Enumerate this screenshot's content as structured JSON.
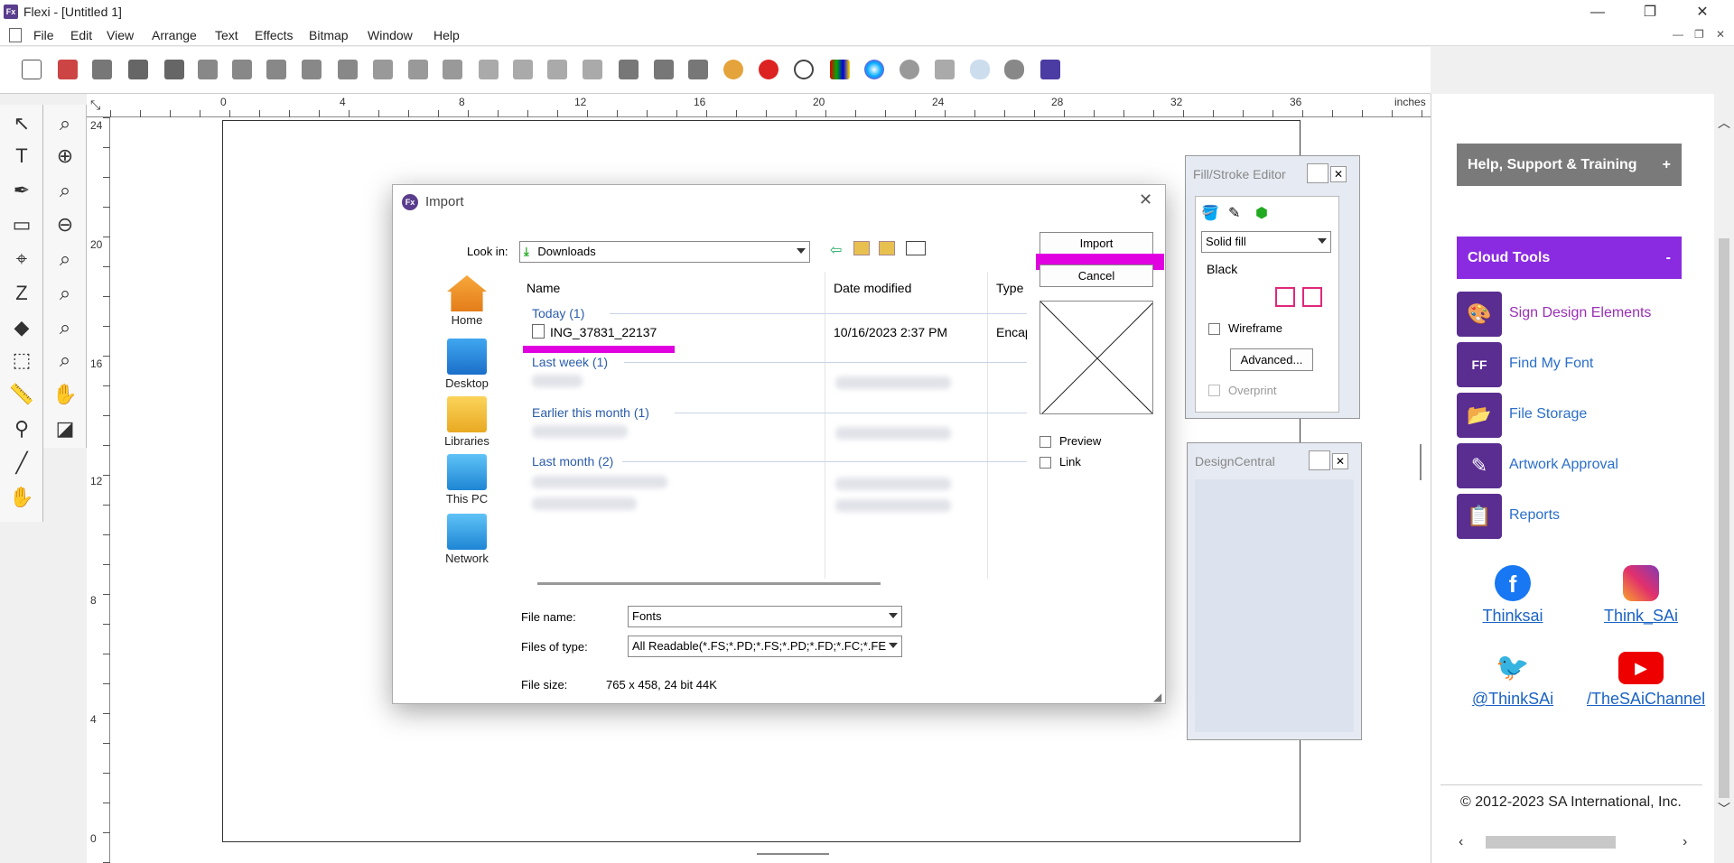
{
  "window": {
    "title": "Flexi - [Untitled 1]",
    "app_icon": "Fx"
  },
  "menu": [
    "File",
    "Edit",
    "View",
    "Arrange",
    "Text",
    "Effects",
    "Bitmap",
    "Window",
    "Help"
  ],
  "ruler": {
    "unit": "inches",
    "h_ticks": [
      "0",
      "4",
      "8",
      "12",
      "16",
      "20",
      "24",
      "28",
      "32",
      "36"
    ],
    "v_ticks": [
      "24",
      "20",
      "16",
      "12",
      "8",
      "4",
      "0"
    ]
  },
  "colors": {
    "accent_purple": "#5a2d91",
    "cloud_tools_bg": "#8a2be2",
    "help_bg": "#7a7a7a",
    "highlight_magenta": "#e000e0",
    "link_blue": "#2a6fc9"
  },
  "fill_stroke": {
    "title": "Fill/Stroke Editor",
    "fill_type": "Solid fill",
    "color_name": "Black",
    "wireframe_label": "Wireframe",
    "advanced_label": "Advanced...",
    "overprint_label": "Overprint"
  },
  "design_central": {
    "title": "DesignCentral"
  },
  "right_panel": {
    "help_header": "Help, Support & Training",
    "help_toggle": "+",
    "cloud_header": "Cloud Tools",
    "cloud_toggle": "-",
    "items": [
      {
        "label": "Sign Design Elements",
        "icon": "palette-icon"
      },
      {
        "label": "Find My Font",
        "icon": "ff-icon"
      },
      {
        "label": "File Storage",
        "icon": "folder-icon"
      },
      {
        "label": "Artwork Approval",
        "icon": "pen-icon"
      },
      {
        "label": "Reports",
        "icon": "report-icon"
      }
    ],
    "social": [
      {
        "label": "Thinksai",
        "icon": "facebook-icon"
      },
      {
        "label": "Think_SAi",
        "icon": "instagram-icon"
      },
      {
        "label": "@ThinkSAi",
        "icon": "twitter-icon"
      },
      {
        "label": "/TheSAiChannel",
        "icon": "youtube-icon"
      }
    ],
    "copyright": "© 2012-2023 SA International, Inc."
  },
  "dialog": {
    "title": "Import",
    "look_in_label": "Look in:",
    "look_in_value": "Downloads",
    "places": [
      "Home",
      "Desktop",
      "Libraries",
      "This PC",
      "Network"
    ],
    "columns": [
      "Name",
      "Date modified",
      "Type"
    ],
    "groups": [
      "Today (1)",
      "Last week (1)",
      "Earlier this month (1)",
      "Last month (2)"
    ],
    "file": {
      "name": "ING_37831_22137",
      "date": "10/16/2023 2:37 PM",
      "type": "Encap"
    },
    "import_button": "Import",
    "cancel_button": "Cancel",
    "preview_label": "Preview",
    "link_label": "Link",
    "file_name_label": "File name:",
    "file_name_value": "Fonts",
    "files_of_type_label": "Files of type:",
    "files_of_type_value": "All Readable(*.FS;*.PD;*.FS;*.PD;*.FD;*.FC;*.FE",
    "file_size_label": "File size:",
    "file_size_value": "765 x 458, 24 bit 44K"
  }
}
